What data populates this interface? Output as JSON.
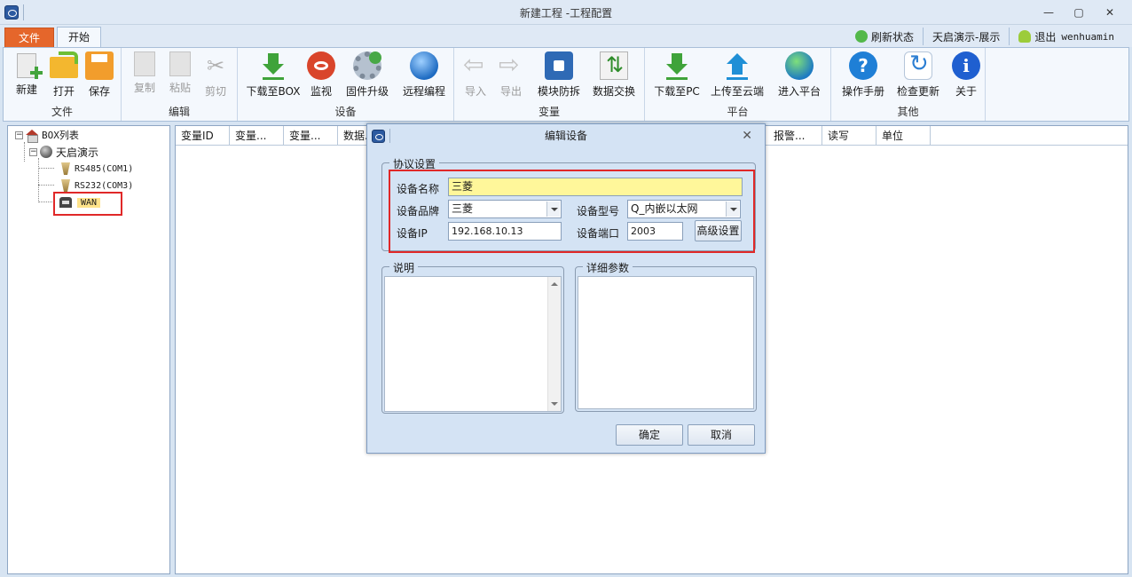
{
  "window": {
    "title": "新建工程 -工程配置",
    "minimize": "—",
    "maximize": "▢",
    "close": "✕"
  },
  "ribbon_tabs": {
    "file": "文件",
    "start": "开始"
  },
  "top_right": {
    "refresh_status": "刷新状态",
    "project": "天启演示-展示",
    "logout": "退出",
    "username": "wenhuamin"
  },
  "ribbon": {
    "groups": {
      "file": "文件",
      "edit": "编辑",
      "device": "设备",
      "variable": "变量",
      "platform": "平台",
      "other": "其他"
    },
    "buttons": {
      "new": "新建",
      "open": "打开",
      "save": "保存",
      "copy": "复制",
      "paste": "粘贴",
      "cut": "剪切",
      "download_box": "下载至BOX",
      "monitor": "监视",
      "firmware_upgrade": "固件升级",
      "remote_program": "远程编程",
      "import": "导入",
      "export": "导出",
      "module_protect": "模块防拆",
      "data_exchange": "数据交换",
      "download_pc": "下载至PC",
      "upload_cloud": "上传至云端",
      "enter_platform": "进入平台",
      "manual": "操作手册",
      "check_update": "检查更新",
      "about": "关于"
    }
  },
  "tree": {
    "root": "BOX列表",
    "device": "天启演示",
    "ports": [
      "RS485(COM1)",
      "RS232(COM3)",
      "WAN"
    ],
    "expander_minus": "−"
  },
  "grid": {
    "columns": [
      "变量ID",
      "变量...",
      "变量...",
      "数据...",
      "报警...",
      "读写",
      "单位"
    ]
  },
  "dialog": {
    "title": "编辑设备",
    "close": "✕",
    "protocol_group": "协议设置",
    "device_name_label": "设备名称",
    "device_name_value": "三菱",
    "brand_label": "设备品牌",
    "brand_value": "三菱",
    "model_label": "设备型号",
    "model_value": "Q_内嵌以太网",
    "ip_label": "设备IP",
    "ip_value": "192.168.10.13",
    "port_label": "设备端口",
    "port_value": "2003",
    "advanced": "高级设置",
    "desc_group": "说明",
    "params_group": "详细参数",
    "ok": "确定",
    "cancel": "取消"
  },
  "colors": {
    "file_tab": "#e5662b",
    "highlight_box": "#e02828",
    "name_field": "#fff79a"
  }
}
